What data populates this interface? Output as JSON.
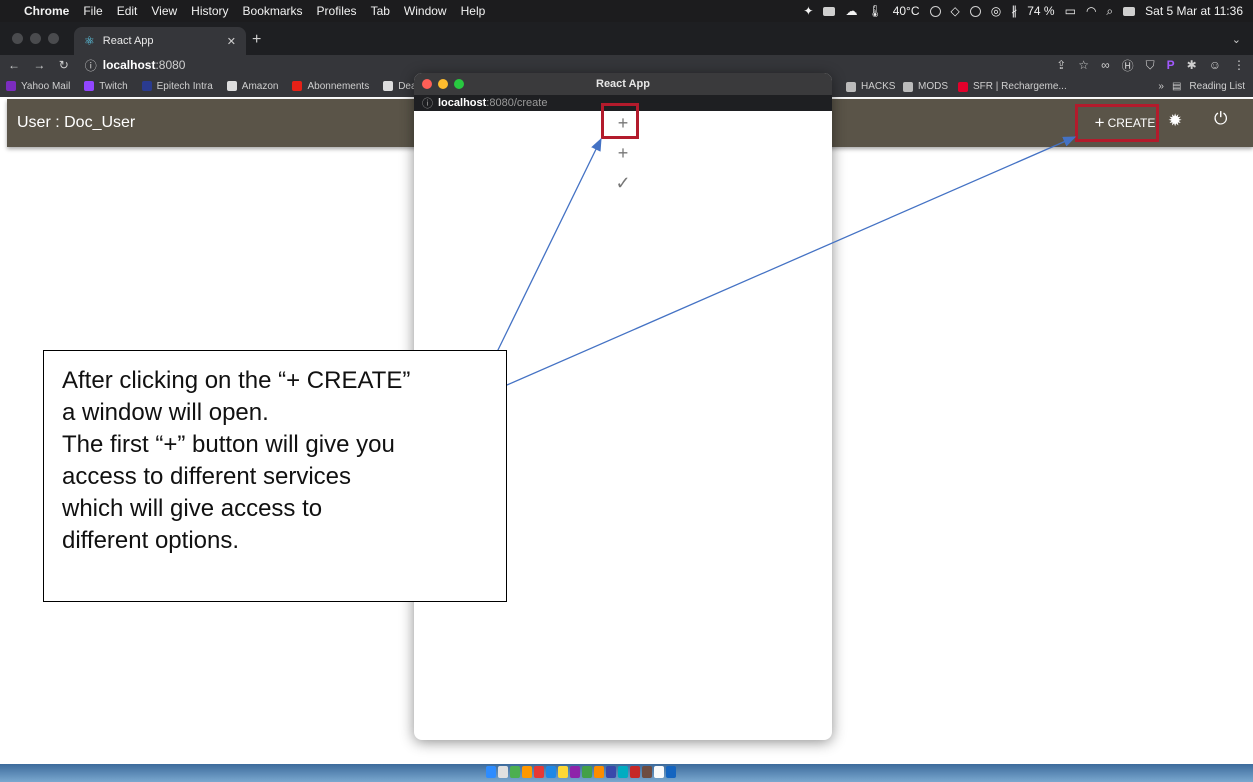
{
  "menubar": {
    "app_name": "Chrome",
    "menus": [
      "File",
      "Edit",
      "View",
      "History",
      "Bookmarks",
      "Profiles",
      "Tab",
      "Window",
      "Help"
    ],
    "temperature": "40°C",
    "battery": "74 %",
    "datetime": "Sat 5 Mar at 11:36"
  },
  "browser": {
    "tab_title": "React App",
    "url_host": "localhost",
    "url_rest": ":8080",
    "bookmarks": [
      {
        "label": "Yahoo Mail",
        "color": "#7b2cbf"
      },
      {
        "label": "Twitch",
        "color": "#9146ff"
      },
      {
        "label": "Epitech Intra",
        "color": "#2a3b8f"
      },
      {
        "label": "Amazon",
        "color": "#dddddd"
      },
      {
        "label": "Abonnements",
        "color": "#e62117"
      },
      {
        "label": "Dealabs",
        "color": "#dddddd"
      }
    ],
    "bookmarks_right": [
      {
        "label": "HACKS",
        "color": "#bbbbbb"
      },
      {
        "label": "MODS",
        "color": "#bbbbbb"
      },
      {
        "label": "SFR | Rechargeme...",
        "color": "#e4002b"
      }
    ],
    "reading_list": "Reading List"
  },
  "app": {
    "user_label": "User : Doc_User",
    "create_label": "CREATE",
    "accent": "#5a5448",
    "highlight": "#b31b2c"
  },
  "popup": {
    "title": "React App",
    "url_host": "localhost",
    "url_rest": ":8080/create"
  },
  "annotation": {
    "lines": [
      "After clicking on the “+ CREATE”",
      "a window will open.",
      "The first “+” button will give you",
      "access to different services",
      "which will give access to",
      "different options."
    ],
    "arrow_color": "#4472c4"
  }
}
